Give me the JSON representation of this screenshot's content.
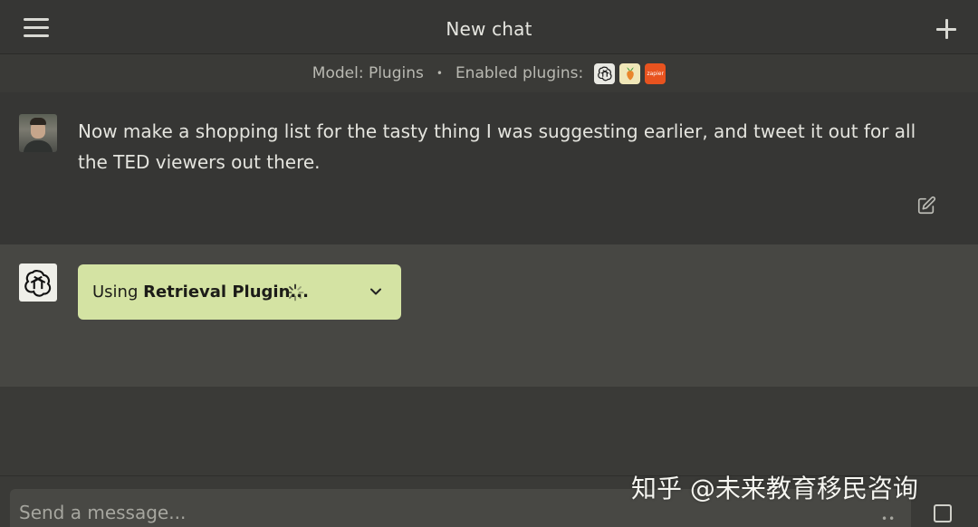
{
  "header": {
    "title": "New chat",
    "menu_icon": "hamburger-menu-icon",
    "new_chat_icon": "plus-icon"
  },
  "model_bar": {
    "model_text": "Model: Plugins",
    "separator": "•",
    "plugins_label": "Enabled plugins:",
    "plugins": [
      {
        "name": "openai-plugin-icon"
      },
      {
        "name": "instacart-plugin-icon"
      },
      {
        "name": "zapier-plugin-icon",
        "text": "zapier"
      }
    ]
  },
  "user_message": {
    "avatar": "user-avatar",
    "text": "Now make a shopping list for the tasty thing I was suggesting earlier, and tweet it out for all the TED viewers out there.",
    "edit_icon": "edit-icon"
  },
  "assistant_message": {
    "avatar": "openai-logo-icon",
    "plugin_status": {
      "prefix": "Using ",
      "plugin_name": "Retrieval Plugin...",
      "icons": [
        "spinner-icon",
        "chevron-down-icon"
      ]
    }
  },
  "composer": {
    "placeholder": "Send a message..."
  },
  "watermark": {
    "text": "知乎 @未来教育移民咨询"
  },
  "colors": {
    "background": "#353532",
    "assistant_background": "#474743",
    "plugin_pill": "#d4e3a3",
    "text": "#e4e4de"
  }
}
